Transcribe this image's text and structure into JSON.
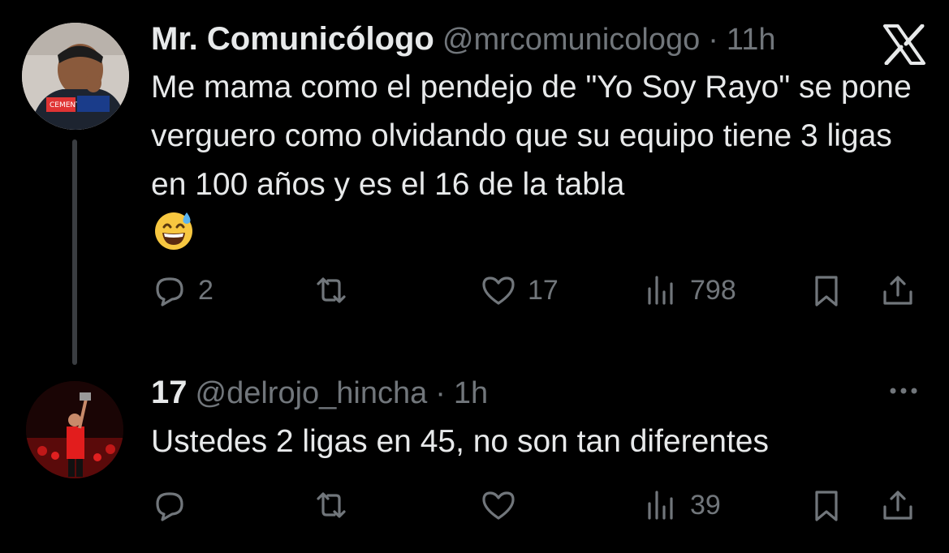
{
  "tweets": [
    {
      "author_name": "Mr. Comunicólogo",
      "handle": "@mrcomunicologo",
      "separator": "·",
      "time": "11h",
      "text": "Me mama como el pendejo de \"Yo Soy Rayo\" se pone verguero como olvidando que su equipo tiene 3 ligas en 100 años y es el 16 de la tabla",
      "emoji": "grinning-face-with-sweat",
      "metrics": {
        "replies": "2",
        "retweets": "",
        "likes": "17",
        "views": "798"
      }
    },
    {
      "author_name": "17",
      "handle": "@delrojo_hincha",
      "separator": "·",
      "time": "1h",
      "text": "Ustedes 2 ligas en 45, no son tan diferentes",
      "metrics": {
        "replies": "",
        "retweets": "",
        "likes": "",
        "views": "39"
      }
    }
  ],
  "icons": {
    "brand": "x-logo",
    "reply": "reply-icon",
    "retweet": "retweet-icon",
    "like": "heart-icon",
    "views": "views-icon",
    "bookmark": "bookmark-icon",
    "share": "share-icon",
    "more": "more-icon"
  },
  "colors": {
    "background": "#000000",
    "text": "#e7e9ea",
    "muted": "#71767b",
    "thread": "#3a3d41"
  }
}
